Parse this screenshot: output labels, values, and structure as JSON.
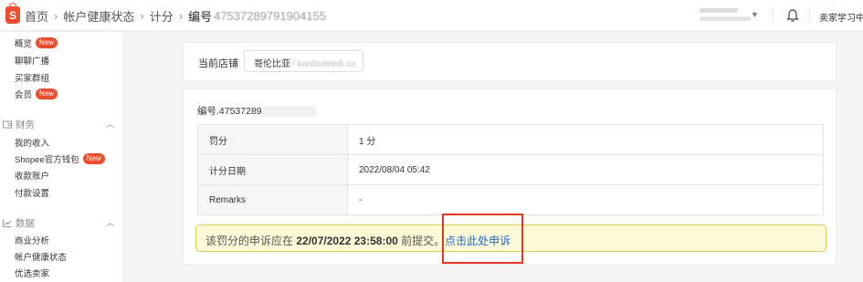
{
  "header": {
    "home": "首页",
    "crumb_account": "帐户健康状态",
    "crumb_points": "计分",
    "crumb_id_label": "编号",
    "crumb_id_value": "47537289791904155",
    "learn": "卖家学习中"
  },
  "sidebar": {
    "items_top": [
      {
        "label": "概览",
        "badge": "New"
      },
      {
        "label": "聊聊广播",
        "badge": ""
      },
      {
        "label": "买家群组",
        "badge": ""
      },
      {
        "label": "会员",
        "badge": "New"
      }
    ],
    "finance": {
      "title": "财务",
      "items": [
        {
          "label": "我的收入",
          "badge": ""
        },
        {
          "label": "Shopee官方钱包",
          "badge": "New"
        },
        {
          "label": "收款账户",
          "badge": ""
        },
        {
          "label": "付款设置",
          "badge": ""
        }
      ]
    },
    "data": {
      "title": "数据",
      "items": [
        {
          "label": "商业分析"
        },
        {
          "label": "帐户健康状态"
        },
        {
          "label": "优选卖家"
        }
      ]
    }
  },
  "store": {
    "label": "当前店铺",
    "value": "哥伦比亚",
    "value_blur": "/ koolboleedi.co"
  },
  "record": {
    "id_label": "编号.47537289",
    "rows": [
      {
        "key": "罚分",
        "value": "1 分"
      },
      {
        "key": "计分日期",
        "value": "2022/08/04 05:42"
      },
      {
        "key": "Remarks",
        "value": "-"
      }
    ]
  },
  "notice": {
    "prefix": "该罚分的申诉应在",
    "deadline": "22/07/2022 23:58:00",
    "suffix": "前提交。",
    "link": "点击此处申诉"
  },
  "colors": {
    "brand": "#ee4d2d",
    "link": "#1c69c9",
    "notice_bg": "#fcfad7",
    "notice_border": "#e0cc5c",
    "highlight": "#e5391f"
  }
}
